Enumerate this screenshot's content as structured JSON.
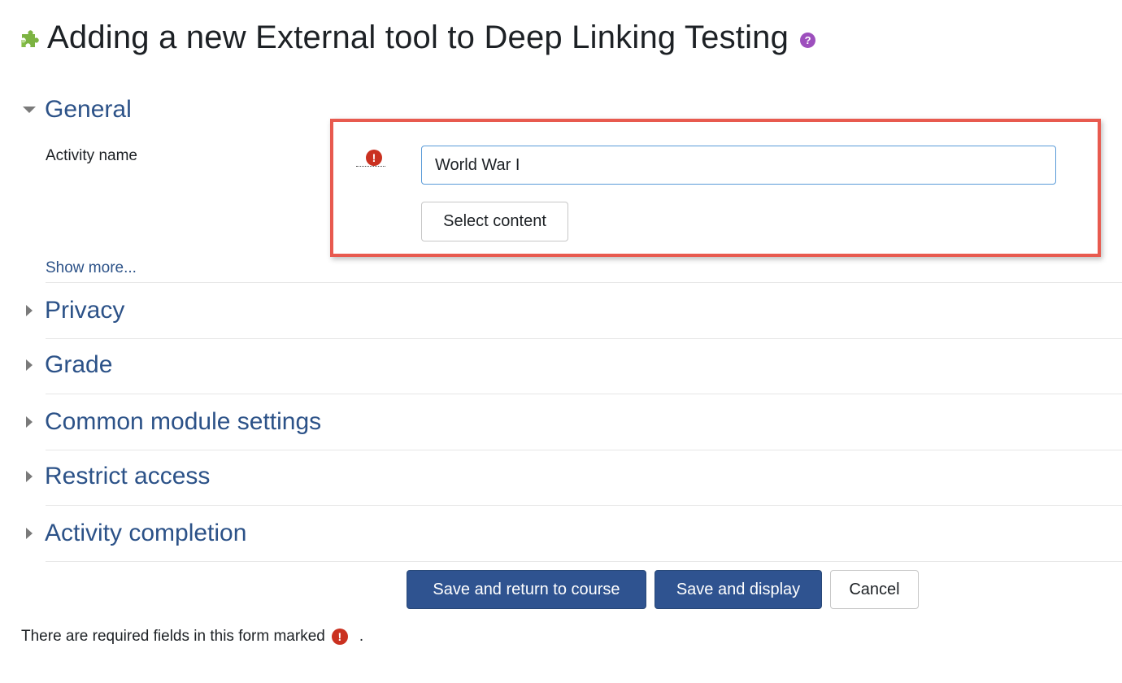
{
  "page": {
    "title": "Adding a new External tool to Deep Linking Testing",
    "help_icon": "?"
  },
  "sections": {
    "general": "General",
    "privacy": "Privacy",
    "grade": "Grade",
    "common_module_settings": "Common module settings",
    "restrict_access": "Restrict access",
    "activity_completion": "Activity completion"
  },
  "general": {
    "activity_name_label": "Activity name",
    "activity_name_value": "World War I",
    "required_glyph": "!",
    "select_content_label": "Select content",
    "show_more_label": "Show more..."
  },
  "actions": {
    "save_return_label": "Save and return to course",
    "save_display_label": "Save and display",
    "cancel_label": "Cancel"
  },
  "footer": {
    "required_note": "There are required fields in this form marked",
    "required_glyph": "!",
    "period": "."
  },
  "colors": {
    "link_blue": "#2c5288",
    "primary_button": "#2f5390",
    "required_red": "#ca3120",
    "highlight_border": "#e85a4f",
    "help_purple": "#9d4fbd",
    "puzzle_green": "#7cb342"
  },
  "icons": {
    "activity": "puzzle-piece-icon",
    "help": "question-circle-icon",
    "required": "exclamation-circle-icon",
    "expanded": "caret-down-icon",
    "collapsed": "caret-right-icon"
  }
}
